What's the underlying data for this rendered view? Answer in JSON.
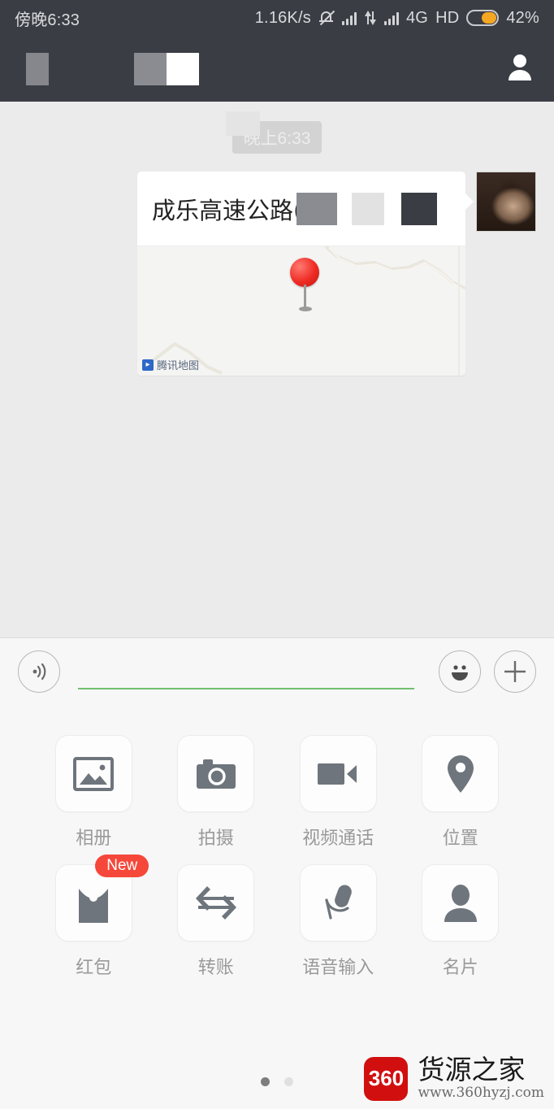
{
  "status_bar": {
    "time": "傍晚6:33",
    "network_speed": "1.16K/s",
    "mute_icon": "bell-off-icon",
    "signal_icon": "signal-bars-icon",
    "data_transfer_icon": "data-transfer-icon",
    "signal_icon_2": "signal-bars-icon",
    "network_type": "4G",
    "hd_label": "HD",
    "battery_icon": "battery-icon",
    "battery_percent": "42%",
    "colors": {
      "background": "#3a3d44",
      "text": "#d9dadc",
      "battery_fill": "#f5a623"
    }
  },
  "nav_bar": {
    "back_icon": "back-redacted-block",
    "title_block_a": "title-redacted-block",
    "title_block_b": "title-redacted-block",
    "profile_icon": "person-icon",
    "background": "#3a3d44"
  },
  "chat": {
    "timestamp": "晚上6:33",
    "message": {
      "type": "location",
      "location_title": "成乐高速公路(",
      "redacted_blocks": [
        "gray",
        "light-gray",
        "dark"
      ],
      "map": {
        "watermark": "腾讯地图",
        "watermark_logo": "tencent-map-logo",
        "pin": "location-pin-icon"
      },
      "avatar": "user-avatar"
    }
  },
  "input_bar": {
    "voice_icon": "voice-input-icon",
    "text_placeholder": "",
    "text_value": "",
    "emoji_icon": "emoji-icon",
    "add_icon": "plus-icon",
    "caret_color": "#6fc06f"
  },
  "attachment_panel": {
    "items": [
      {
        "label": "相册",
        "icon": "photo-album-icon",
        "badge": null
      },
      {
        "label": "拍摄",
        "icon": "camera-icon",
        "badge": null
      },
      {
        "label": "视频通话",
        "icon": "video-call-icon",
        "badge": null
      },
      {
        "label": "位置",
        "icon": "location-pin-icon",
        "badge": null
      },
      {
        "label": "红包",
        "icon": "red-packet-icon",
        "badge": "New"
      },
      {
        "label": "转账",
        "icon": "transfer-icon",
        "badge": null
      },
      {
        "label": "语音输入",
        "icon": "microphone-icon",
        "badge": null
      },
      {
        "label": "名片",
        "icon": "contact-card-icon",
        "badge": null
      }
    ],
    "page_dots": {
      "count": 2,
      "active": 0
    },
    "badge_color": "#f5483a"
  },
  "watermark": {
    "logo_text": "360",
    "site_name": "货源之家",
    "url": "www.360hyzj.com",
    "logo_color": "#d10f0f"
  }
}
